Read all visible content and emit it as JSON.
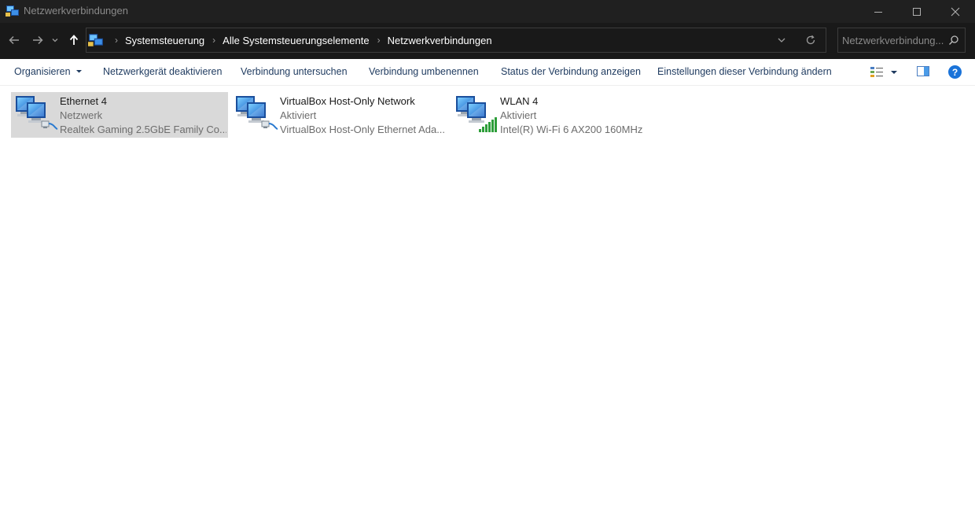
{
  "window": {
    "title": "Netzwerkverbindungen",
    "controls": [
      "minimize-icon",
      "maximize-icon",
      "close-icon"
    ]
  },
  "navigation": {
    "breadcrumbs": [
      "Systemsteuerung",
      "Alle Systemsteuerungselemente",
      "Netzwerkverbindungen"
    ],
    "search_placeholder": "Netzwerkverbindung..."
  },
  "toolbar": {
    "organize_label": "Organisieren",
    "disable_label": "Netzwerkgerät deaktivieren",
    "diagnose_label": "Verbindung untersuchen",
    "rename_label": "Verbindung umbenennen",
    "status_label": "Status der Verbindung anzeigen",
    "settings_label": "Einstellungen dieser Verbindung ändern",
    "help_glyph": "?"
  },
  "connections": [
    {
      "name": "Ethernet 4",
      "status": "Netzwerk",
      "device": "Realtek Gaming 2.5GbE Family Co...",
      "icon": "ethernet-connection-icon",
      "selected": true
    },
    {
      "name": "VirtualBox Host-Only Network",
      "status": "Aktiviert",
      "device": "VirtualBox Host-Only Ethernet Ada...",
      "icon": "ethernet-connection-icon",
      "selected": false
    },
    {
      "name": "WLAN 4",
      "status": "Aktiviert",
      "device": "Intel(R) Wi-Fi 6 AX200 160MHz",
      "icon": "wifi-connection-icon",
      "selected": false
    }
  ],
  "colors": {
    "titlebar": "#202020",
    "addressbar": "#191919",
    "selection": "#d9d9d9",
    "command_text": "#1e3a5f",
    "help_blue": "#1a73d9",
    "signal_green": "#2e9e3a"
  }
}
